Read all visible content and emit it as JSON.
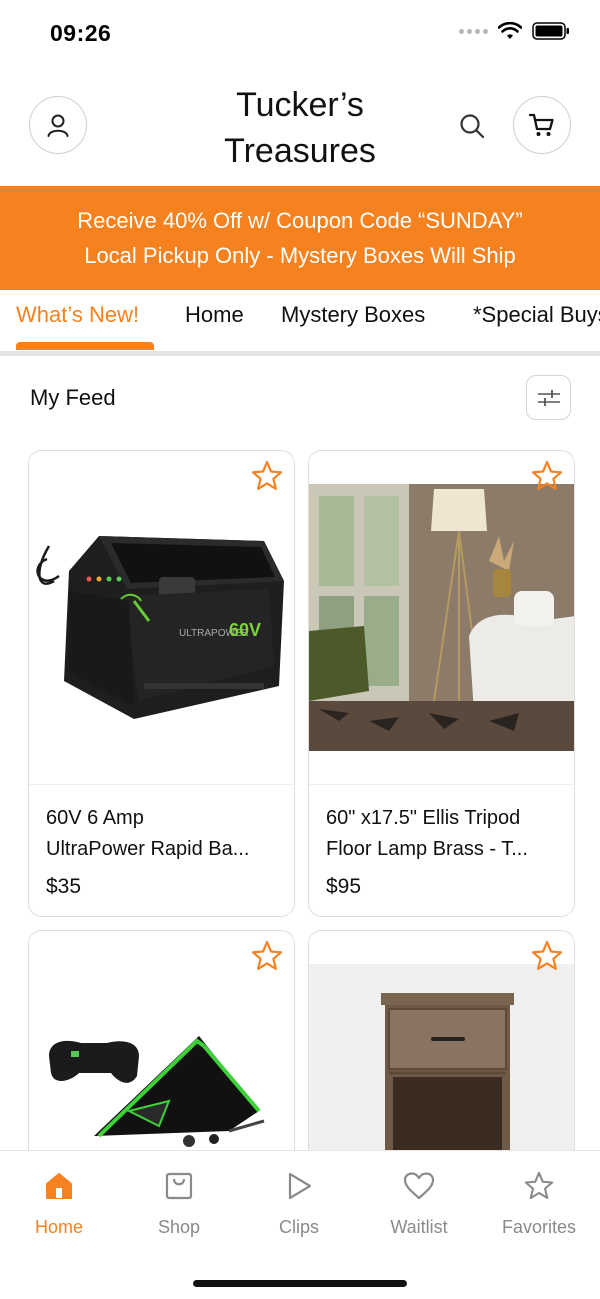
{
  "status": {
    "time": "09:26"
  },
  "header": {
    "title_line1": "Tucker’s",
    "title_line2": "Treasures"
  },
  "promo": {
    "line1": "Receive 40% Off w/ Coupon Code “SUNDAY”",
    "line2": "Local Pickup Only - Mystery Boxes Will Ship"
  },
  "tabs": [
    {
      "label": "What’s New!",
      "active": true
    },
    {
      "label": "Home"
    },
    {
      "label": "Mystery Boxes"
    },
    {
      "label": "*Special Buys"
    }
  ],
  "feed": {
    "title": "My Feed"
  },
  "products": [
    {
      "name_line1": "60V 6 Amp",
      "name_line2": "UltraPower Rapid Ba...",
      "price": "$35",
      "brand_text": "ULTRAPOWER 60V"
    },
    {
      "name_line1": "60\" x17.5\" Ellis Tripod",
      "name_line2": "Floor Lamp Brass - T...",
      "price": "$95"
    },
    {
      "name_line1": "",
      "name_line2": "",
      "price": ""
    },
    {
      "name_line1": "",
      "name_line2": "",
      "price": ""
    }
  ],
  "bottom_nav": [
    {
      "label": "Home",
      "icon": "home-icon",
      "active": true
    },
    {
      "label": "Shop",
      "icon": "shop-bag-icon"
    },
    {
      "label": "Clips",
      "icon": "play-icon"
    },
    {
      "label": "Waitlist",
      "icon": "heart-icon"
    },
    {
      "label": "Favorites",
      "icon": "star-icon"
    }
  ],
  "colors": {
    "accent": "#f6821f",
    "inactive": "#8a8a8a",
    "border": "#dedede"
  }
}
